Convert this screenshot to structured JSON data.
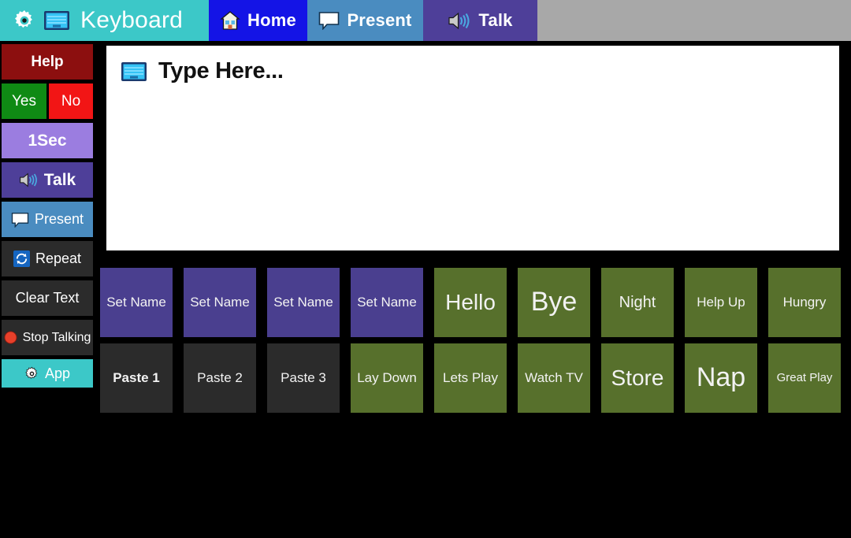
{
  "topbar": {
    "tabs": [
      {
        "label": "Keyboard",
        "icons": [
          "gear-icon",
          "monitor-icon"
        ],
        "state": "inactive",
        "color": "#3cc8c8"
      },
      {
        "label": "Home",
        "icons": [
          "house-icon"
        ],
        "state": "active",
        "color": "#1414e6"
      },
      {
        "label": "Present",
        "icons": [
          "speech-bubble-icon"
        ],
        "state": "inactive",
        "color": "#4a8cc0"
      },
      {
        "label": "Talk",
        "icons": [
          "speaker-icon"
        ],
        "state": "inactive",
        "color": "#4e3f99"
      }
    ]
  },
  "sidebar": {
    "help": "Help",
    "yes": "Yes",
    "no": "No",
    "one_sec": "1Sec",
    "talk": "Talk",
    "present": "Present",
    "repeat": "Repeat",
    "clear_text": "Clear Text",
    "stop_talking": "Stop Talking",
    "app": "App"
  },
  "editor": {
    "title": "Type Here...",
    "icon": "monitor-icon",
    "value": "",
    "placeholder": ""
  },
  "grid": {
    "rows": [
      [
        {
          "label": "Set Name",
          "color": "purple",
          "size": "s",
          "bold": false
        },
        {
          "label": "Set Name",
          "color": "purple",
          "size": "s",
          "bold": false
        },
        {
          "label": "Set Name",
          "color": "purple",
          "size": "s",
          "bold": false
        },
        {
          "label": "Set Name",
          "color": "purple",
          "size": "s",
          "bold": false
        },
        {
          "label": "Hello",
          "color": "green",
          "size": "l",
          "bold": false
        },
        {
          "label": "Bye",
          "color": "green",
          "size": "xl",
          "bold": false
        },
        {
          "label": "Night",
          "color": "green",
          "size": "m",
          "bold": false
        },
        {
          "label": "Help Up",
          "color": "green",
          "size": "s",
          "bold": false
        },
        {
          "label": "Hungry",
          "color": "green",
          "size": "s",
          "bold": false
        }
      ],
      [
        {
          "label": "Paste 1",
          "color": "dark",
          "size": "s",
          "bold": true
        },
        {
          "label": "Paste 2",
          "color": "dark",
          "size": "s",
          "bold": false
        },
        {
          "label": "Paste 3",
          "color": "dark",
          "size": "s",
          "bold": false
        },
        {
          "label": "Lay Down",
          "color": "green",
          "size": "s",
          "bold": false
        },
        {
          "label": "Lets Play",
          "color": "green",
          "size": "s",
          "bold": false
        },
        {
          "label": "Watch TV",
          "color": "green",
          "size": "s",
          "bold": false
        },
        {
          "label": "Store",
          "color": "green",
          "size": "l",
          "bold": false
        },
        {
          "label": "Nap",
          "color": "green",
          "size": "xl",
          "bold": false
        },
        {
          "label": "Great Play",
          "color": "green",
          "size": "xs",
          "bold": false
        }
      ]
    ]
  },
  "colors": {
    "background": "#000000",
    "topbar_filler": "#a8a8a8",
    "teal": "#3cc8c8",
    "blue_active": "#1414e6",
    "steel_blue": "#4a8cc0",
    "purple": "#4e3f99",
    "tile_purple": "#4a3f8f",
    "tile_green": "#57702c",
    "tile_dark": "#2b2b2b",
    "help_red": "#8c0f0f",
    "yes_green": "#0f8a14",
    "no_red": "#f21515",
    "lavender": "#9b7de0",
    "editor_bg": "#ffffff"
  }
}
